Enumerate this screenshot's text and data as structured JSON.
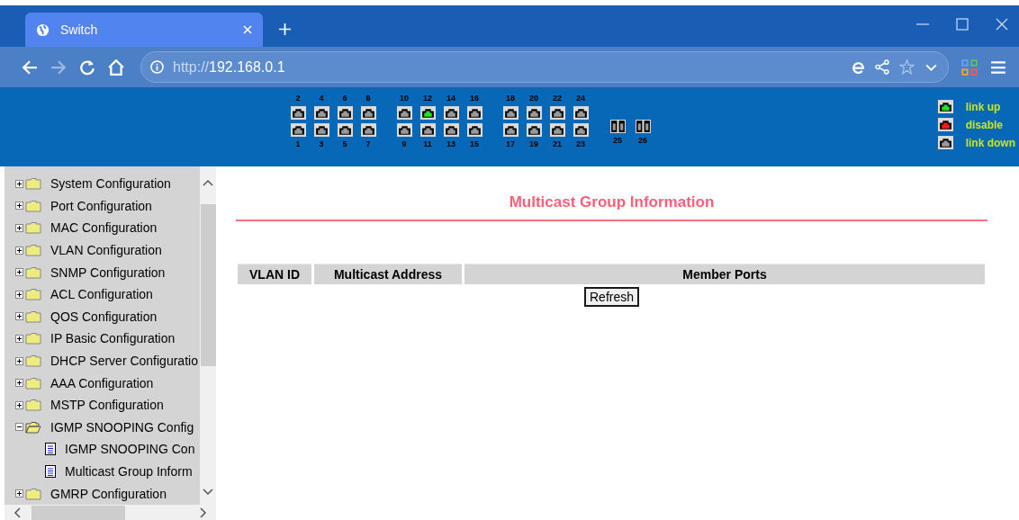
{
  "browser": {
    "tab": {
      "title": "Switch",
      "selected": true
    },
    "url_scheme": "http://",
    "url_host": "192.168.0.1"
  },
  "ports": [
    {
      "kind": "pair",
      "top": {
        "label": "2",
        "link_up": false,
        "disabled": false
      },
      "bottom": {
        "label": "1",
        "link_up": false,
        "disabled": false
      }
    },
    {
      "kind": "pair",
      "top": {
        "label": "4",
        "link_up": false,
        "disabled": false
      },
      "bottom": {
        "label": "3",
        "link_up": false,
        "disabled": false
      }
    },
    {
      "kind": "pair",
      "top": {
        "label": "6",
        "link_up": false,
        "disabled": false
      },
      "bottom": {
        "label": "5",
        "link_up": false,
        "disabled": false
      }
    },
    {
      "kind": "pair",
      "top": {
        "label": "8",
        "link_up": false,
        "disabled": false
      },
      "bottom": {
        "label": "7",
        "link_up": false,
        "disabled": false
      }
    },
    {
      "kind": "gap"
    },
    {
      "kind": "pair",
      "top": {
        "label": "10",
        "link_up": false,
        "disabled": false
      },
      "bottom": {
        "label": "9",
        "link_up": false,
        "disabled": false
      }
    },
    {
      "kind": "pair",
      "top": {
        "label": "12",
        "link_up": true,
        "disabled": false
      },
      "bottom": {
        "label": "11",
        "link_up": false,
        "disabled": false
      }
    },
    {
      "kind": "pair",
      "top": {
        "label": "14",
        "link_up": false,
        "disabled": false
      },
      "bottom": {
        "label": "13",
        "link_up": false,
        "disabled": false
      }
    },
    {
      "kind": "pair",
      "top": {
        "label": "16",
        "link_up": false,
        "disabled": false
      },
      "bottom": {
        "label": "15",
        "link_up": false,
        "disabled": false
      }
    },
    {
      "kind": "gap"
    },
    {
      "kind": "pair",
      "top": {
        "label": "18",
        "link_up": false,
        "disabled": false
      },
      "bottom": {
        "label": "17",
        "link_up": false,
        "disabled": false
      }
    },
    {
      "kind": "pair",
      "top": {
        "label": "20",
        "link_up": false,
        "disabled": false
      },
      "bottom": {
        "label": "19",
        "link_up": false,
        "disabled": false
      }
    },
    {
      "kind": "pair",
      "top": {
        "label": "22",
        "link_up": false,
        "disabled": false
      },
      "bottom": {
        "label": "21",
        "link_up": false,
        "disabled": false
      }
    },
    {
      "kind": "pair",
      "top": {
        "label": "24",
        "link_up": false,
        "disabled": false
      },
      "bottom": {
        "label": "23",
        "link_up": false,
        "disabled": false
      }
    },
    {
      "kind": "gap"
    },
    {
      "kind": "fiber",
      "bottom": {
        "label": "25",
        "link_up": false,
        "disabled": false
      }
    },
    {
      "kind": "fiber",
      "bottom": {
        "label": "26",
        "link_up": false,
        "disabled": false
      }
    }
  ],
  "legend": [
    {
      "label": "link up",
      "link_up": true,
      "disabled": false
    },
    {
      "label": "disable",
      "link_up": false,
      "disabled": true
    },
    {
      "label": "link down",
      "link_up": false,
      "disabled": false
    }
  ],
  "sidebar": {
    "items": [
      {
        "label": "System Configuration",
        "expanded": false
      },
      {
        "label": "Port Configuration",
        "expanded": false
      },
      {
        "label": "MAC Configuration",
        "expanded": false
      },
      {
        "label": "VLAN Configuration",
        "expanded": false
      },
      {
        "label": "SNMP Configuration",
        "expanded": false
      },
      {
        "label": "ACL Configuration",
        "expanded": false
      },
      {
        "label": "QOS Configuration",
        "expanded": false
      },
      {
        "label": "IP Basic Configuration",
        "expanded": false
      },
      {
        "label": "DHCP Server Configuratio",
        "expanded": false
      },
      {
        "label": "AAA Configuration",
        "expanded": false
      },
      {
        "label": "MSTP Configuration",
        "expanded": false
      },
      {
        "label": "IGMP SNOOPING Config",
        "expanded": true,
        "children": [
          {
            "label": "IGMP SNOOPING Con"
          },
          {
            "label": "Multicast Group Inform"
          }
        ]
      },
      {
        "label": "GMRP Configuration",
        "expanded": false
      }
    ]
  },
  "main": {
    "title": "Multicast Group Information",
    "table": {
      "columns": [
        "VLAN ID",
        "Multicast Address",
        "Member Ports"
      ]
    },
    "button": "Refresh"
  }
}
